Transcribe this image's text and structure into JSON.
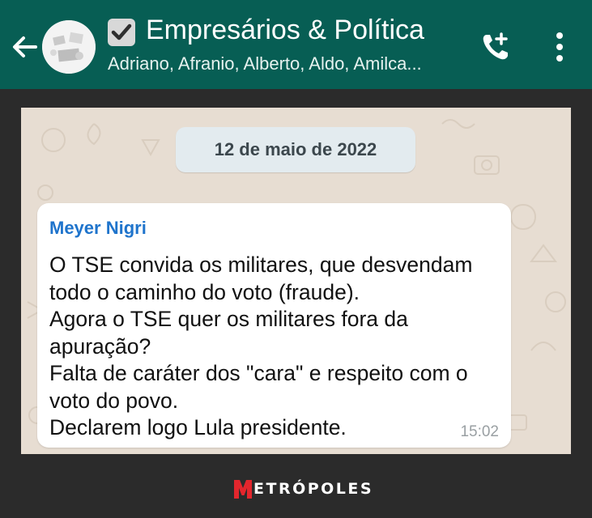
{
  "header": {
    "title": "Empresários & Política",
    "subtitle": "Adriano, Afranio, Alberto, Aldo, Amilca...",
    "icons": [
      "back-arrow-icon",
      "group-avatar",
      "checkbox-icon",
      "add-call-icon",
      "more-vert-icon"
    ],
    "colors": {
      "bar": "#075e54",
      "text": "#ffffff"
    }
  },
  "chat": {
    "date_chip": "12 de maio de 2022",
    "message": {
      "sender": "Meyer Nigri",
      "lines": [
        "O TSE convida os militares, que desvendam",
        "todo o caminho do voto (fraude).",
        "Agora o TSE quer os militares fora da",
        "apuração?",
        "Falta de caráter dos \"cara\" e respeito com o",
        "voto do povo.",
        "Declarem logo Lula presidente."
      ],
      "time": "15:02"
    },
    "colors": {
      "wallpaper": "#e7ddd2",
      "sender": "#1f74cc"
    }
  },
  "footer": {
    "logo_initial": "M",
    "logo_text": "ETRÓPOLES",
    "logo_colors": {
      "initial": "#e3262d",
      "text": "#ffffff"
    }
  }
}
